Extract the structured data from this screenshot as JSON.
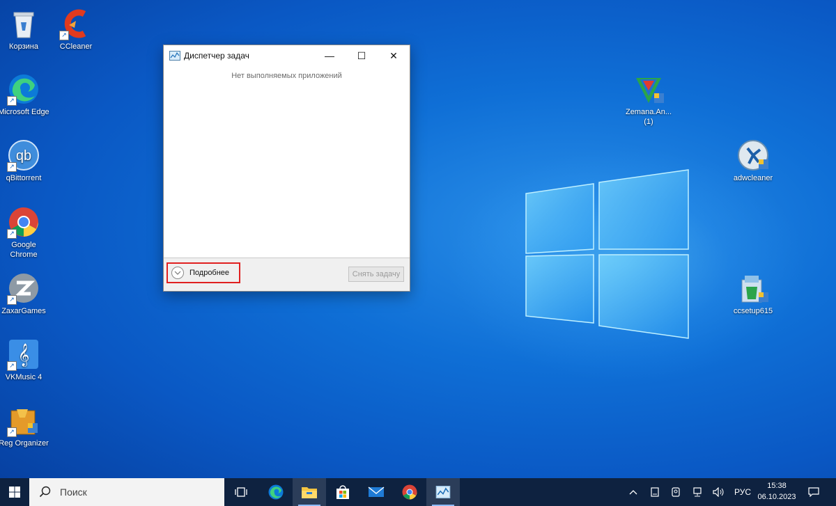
{
  "desktop": {
    "icons": [
      {
        "label": "Корзина",
        "icon": "recycle-bin-icon"
      },
      {
        "label": "CCleaner",
        "icon": "ccleaner-icon"
      },
      {
        "label": "Microsoft Edge",
        "icon": "edge-icon"
      },
      {
        "label": "qBittorrent",
        "icon": "qbittorrent-icon"
      },
      {
        "label": "Google Chrome",
        "icon": "chrome-icon"
      },
      {
        "label": "ZaxarGames",
        "icon": "zaxargames-icon"
      },
      {
        "label": "VKMusic 4",
        "icon": "vkmusic-icon"
      },
      {
        "label": "Reg Organizer",
        "icon": "reg-organizer-icon"
      },
      {
        "label": "Zemana.An... (1)",
        "icon": "zemana-icon"
      },
      {
        "label": "adwcleaner",
        "icon": "adwcleaner-icon"
      },
      {
        "label": "ccsetup615",
        "icon": "ccsetup-icon"
      }
    ]
  },
  "task_manager": {
    "title": "Диспетчер задач",
    "minimize_glyph": "—",
    "maximize_glyph": "☐",
    "close_glyph": "✕",
    "empty_message": "Нет выполняемых приложений",
    "more_details_label": "Подробнее",
    "end_task_label": "Снять задачу",
    "highlight_color": "#e02020"
  },
  "taskbar": {
    "search_placeholder": "Поиск",
    "language": "РУС",
    "time": "15:38",
    "date": "06.10.2023",
    "apps": [
      "task-view-icon",
      "edge-icon",
      "file-explorer-icon",
      "microsoft-store-icon",
      "mail-icon",
      "chrome-icon",
      "task-manager-icon"
    ],
    "active_app": "file-explorer-icon"
  },
  "colors": {
    "taskbar_bg": "#0e2240",
    "desktop_accent": "#0f6fd6"
  }
}
